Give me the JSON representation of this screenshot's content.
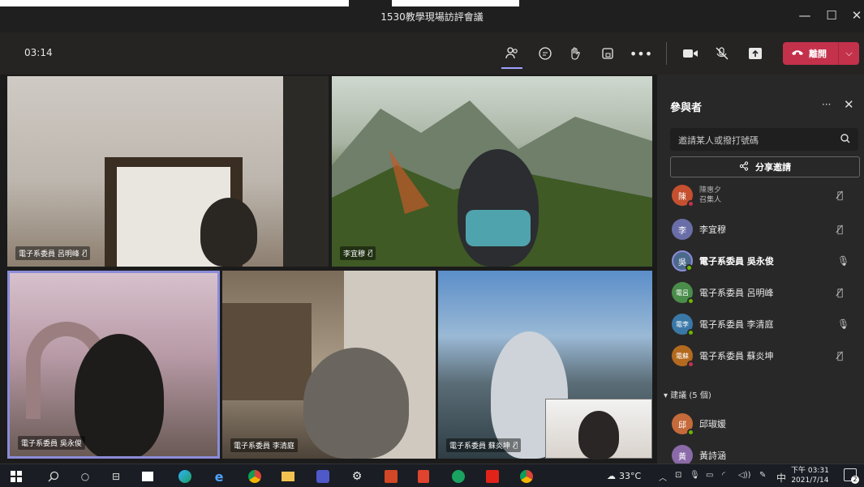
{
  "window": {
    "title": "1530教學現場訪評會議",
    "minimize": "—",
    "maximize": "☐",
    "close": "✕"
  },
  "toolbar": {
    "timer": "03:14",
    "leave_label": "離開",
    "icons": [
      "people-icon",
      "chat-icon",
      "raise-hand-icon",
      "rooms-icon",
      "more-icon",
      "camera-icon",
      "mic-off-icon",
      "share-tray-icon"
    ]
  },
  "tiles": [
    {
      "name": "電子系委員 呂明峰"
    },
    {
      "name": "李宜穆"
    },
    {
      "name": "電子系委員 吳永俊"
    },
    {
      "name": "電子系委員 李清庭"
    },
    {
      "name": "電子系委員 蘇炎坤"
    }
  ],
  "panel": {
    "title": "參與者",
    "more": "···",
    "close": "✕",
    "search_placeholder": "邀請某人或撥打號碼",
    "share_label": "分享邀請",
    "participants": [
      {
        "initial": "陳",
        "name": "陳惠夕",
        "sub": "召集人",
        "color": "#c4502f"
      },
      {
        "initial": "李",
        "name": "李宜穆",
        "sub": "",
        "color": "#6a6ea8"
      },
      {
        "initial": "吳",
        "name": "電子系委員 吳永俊",
        "sub": "",
        "color": "#4b6a8b"
      },
      {
        "initial": "電呂",
        "name": "電子系委員 呂明峰",
        "sub": "",
        "color": "#4a8d4a"
      },
      {
        "initial": "電李",
        "name": "電子系委員 李清庭",
        "sub": "",
        "color": "#3a78a8"
      },
      {
        "initial": "電蘇",
        "name": "電子系委員 蘇炎坤",
        "sub": "",
        "color": "#b36a1f"
      }
    ],
    "suggestions_label": "建議 (5 個)",
    "suggestions": [
      {
        "initial": "邱",
        "name": "邱琡媛",
        "color": "#c56a3a"
      },
      {
        "initial": "黃",
        "name": "黃詩涵",
        "color": "#8a6aa8"
      }
    ]
  },
  "taskbar": {
    "weather": "33°C",
    "time": "下午 03:31",
    "date": "2021/7/14",
    "ime": "中",
    "notifications": "2"
  }
}
